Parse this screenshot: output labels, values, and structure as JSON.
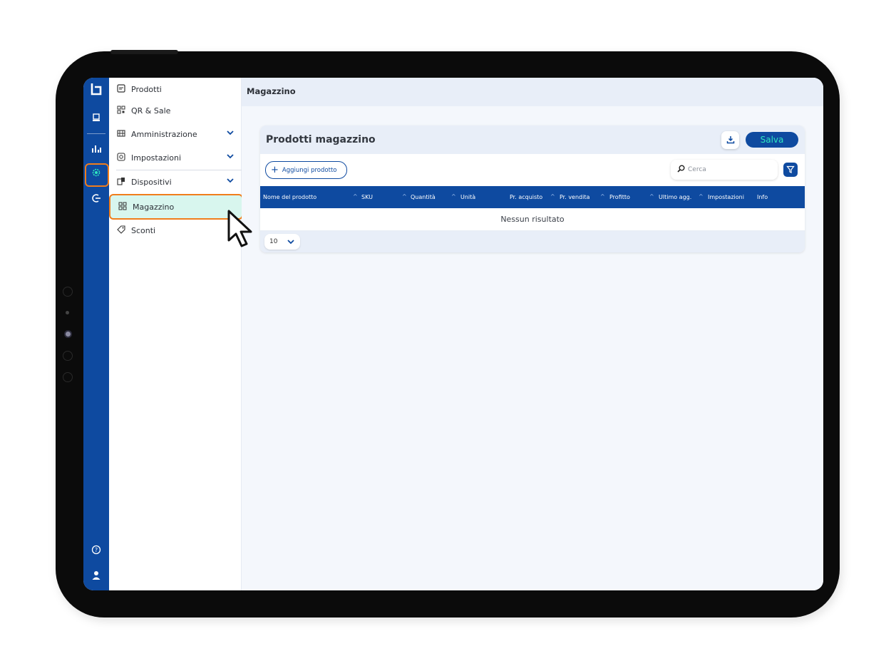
{
  "menu": {
    "items": [
      {
        "label": "Prodotti",
        "icon": "product-box-icon"
      },
      {
        "label": "QR & Sale",
        "icon": "qr-code-icon"
      },
      {
        "label": "Amministrazione",
        "icon": "administration-icon"
      },
      {
        "label": "Impostazioni",
        "icon": "settings-icon"
      },
      {
        "label": "Dispositivi",
        "icon": "devices-icon"
      },
      {
        "label": "Magazzino",
        "icon": "warehouse-icon"
      },
      {
        "label": "Sconti",
        "icon": "discount-tag-icon"
      }
    ]
  },
  "main": {
    "title": "Magazzino"
  },
  "card": {
    "title": "Prodotti magazzino",
    "save_label": "Salva",
    "add_label": "Aggiungi prodotto",
    "search_placeholder": "Cerca",
    "columns": [
      {
        "label": "Nome del prodotto"
      },
      {
        "label": "SKU"
      },
      {
        "label": "Quantità"
      },
      {
        "label": "Unità"
      },
      {
        "label": "Pr. acquisto"
      },
      {
        "label": "Pr. vendita"
      },
      {
        "label": "Profitto"
      },
      {
        "label": "Ultimo agg."
      },
      {
        "label": "Impostazioni"
      },
      {
        "label": "Info"
      }
    ],
    "empty_text": "Nessun risultato",
    "page_size": "10"
  },
  "colors": {
    "primary": "#0e4aa0",
    "accent": "#2ee6c0",
    "highlight": "#f07d1c",
    "active_bg": "#d8f6ee"
  }
}
